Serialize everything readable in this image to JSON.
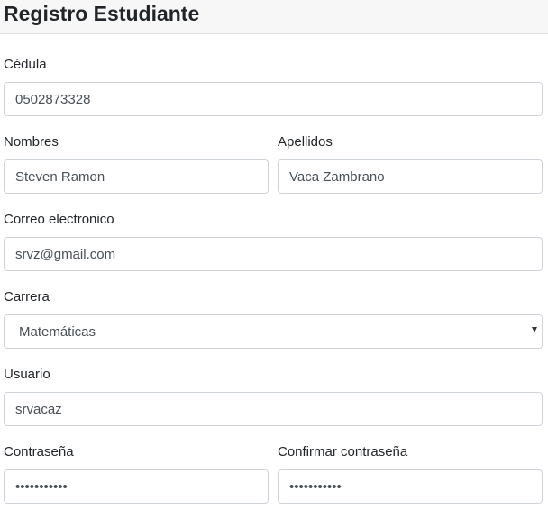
{
  "page": {
    "title": "Registro Estudiante"
  },
  "form": {
    "cedula": {
      "label": "Cédula",
      "value": "0502873328"
    },
    "nombres": {
      "label": "Nombres",
      "value": "Steven Ramon"
    },
    "apellidos": {
      "label": "Apellidos",
      "value": "Vaca Zambrano"
    },
    "correo": {
      "label": "Correo electronico",
      "value": "srvz@gmail.com"
    },
    "carrera": {
      "label": "Carrera",
      "selected": "Matemáticas"
    },
    "usuario": {
      "label": "Usuario",
      "value": "srvacaz"
    },
    "contrasena": {
      "label": "Contraseña",
      "value": "•••••••••••"
    },
    "confirmar": {
      "label": "Confirmar contraseña",
      "value": "•••••••••••"
    }
  },
  "icons": {
    "carrera_dropdown": "chevron-down-icon"
  }
}
